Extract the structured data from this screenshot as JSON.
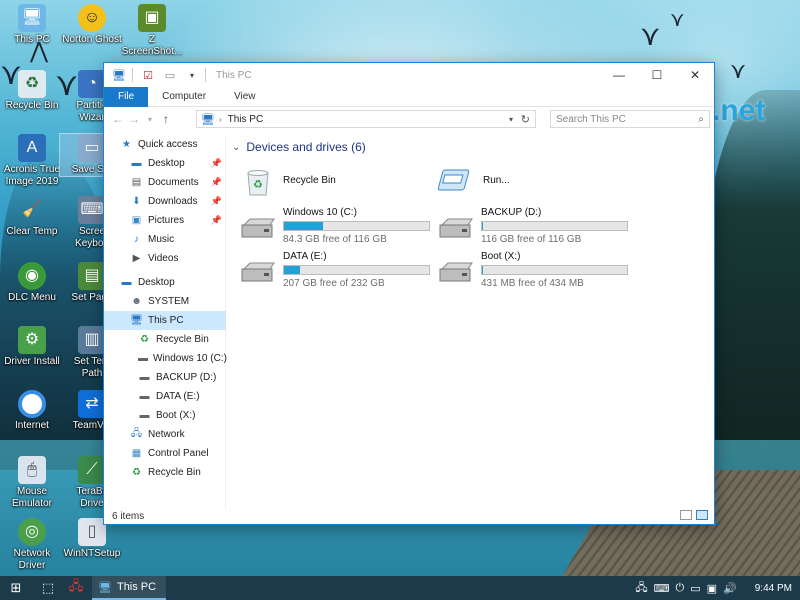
{
  "watermark": "freetuts.net",
  "desktop_icons": [
    {
      "label": "This PC",
      "icon": "computer-icon"
    },
    {
      "label": "Norton Ghost",
      "icon": "ghost-icon"
    },
    {
      "label": "Z",
      "label2": "ScreenShot...",
      "icon": "screenshot-icon"
    },
    {
      "label": "Recycle Bin",
      "icon": "recycle-bin-icon"
    },
    {
      "label": "Partitio",
      "label2": "Wizar",
      "icon": "partition-icon"
    },
    {
      "label": "Acronis True",
      "label2": "Image 2019",
      "icon": "acronis-icon"
    },
    {
      "label": "Save Scr",
      "icon": "save-screen-icon"
    },
    {
      "label": "Clear Temp",
      "icon": "broom-icon"
    },
    {
      "label": "Scree",
      "label2": "Keyboa",
      "icon": "keyboard-icon"
    },
    {
      "label": "DLC Menu",
      "icon": "dlc-menu-icon"
    },
    {
      "label": "Set Page",
      "icon": "page-file-icon"
    },
    {
      "label": "Driver Install",
      "icon": "driver-install-icon"
    },
    {
      "label": "Set Tem",
      "label2": "Path",
      "icon": "temp-path-icon"
    },
    {
      "label": "Internet",
      "icon": "chrome-icon"
    },
    {
      "label": "TeamVie",
      "icon": "teamviewer-icon"
    },
    {
      "label": "Mouse",
      "label2": "Emulator",
      "icon": "mouse-emulator-icon"
    },
    {
      "label": "TeraBy",
      "label2": "Drive",
      "icon": "terabyte-icon"
    },
    {
      "label": "Network",
      "label2": "Driver",
      "icon": "network-driver-icon"
    },
    {
      "label": "WinNTSetup",
      "icon": "winntsetup-icon"
    }
  ],
  "window": {
    "title": "This PC",
    "tabs": {
      "file": "File",
      "computer": "Computer",
      "view": "View"
    },
    "address": {
      "path": "This PC"
    },
    "search": {
      "placeholder": "Search This PC"
    },
    "controls": {
      "minimize": "—",
      "maximize": "☐",
      "close": "✕"
    }
  },
  "nav": {
    "items": [
      {
        "label": "Quick access",
        "icon": "star-icon",
        "pinned": false,
        "level": 0
      },
      {
        "label": "Desktop",
        "icon": "desktop-icon",
        "pinned": true,
        "level": 1
      },
      {
        "label": "Documents",
        "icon": "documents-icon",
        "pinned": true,
        "level": 1
      },
      {
        "label": "Downloads",
        "icon": "downloads-icon",
        "pinned": true,
        "level": 1
      },
      {
        "label": "Pictures",
        "icon": "pictures-icon",
        "pinned": true,
        "level": 1
      },
      {
        "label": "Music",
        "icon": "music-icon",
        "pinned": false,
        "level": 1
      },
      {
        "label": "Videos",
        "icon": "videos-icon",
        "pinned": false,
        "level": 1
      },
      {
        "label": "Desktop",
        "icon": "desktop-icon",
        "pinned": false,
        "level": 0
      },
      {
        "label": "SYSTEM",
        "icon": "user-icon",
        "pinned": false,
        "level": 1
      },
      {
        "label": "This PC",
        "icon": "computer-icon",
        "pinned": false,
        "level": 1,
        "selected": true
      },
      {
        "label": "Recycle Bin",
        "icon": "recycle-bin-icon",
        "pinned": false,
        "level": 2
      },
      {
        "label": "Windows 10 (C:)",
        "icon": "drive-icon",
        "pinned": false,
        "level": 2
      },
      {
        "label": "BACKUP (D:)",
        "icon": "drive-icon",
        "pinned": false,
        "level": 2
      },
      {
        "label": "DATA (E:)",
        "icon": "drive-icon",
        "pinned": false,
        "level": 2
      },
      {
        "label": "Boot (X:)",
        "icon": "drive-icon",
        "pinned": false,
        "level": 2
      },
      {
        "label": "Network",
        "icon": "network-icon",
        "pinned": false,
        "level": 1
      },
      {
        "label": "Control Panel",
        "icon": "control-panel-icon",
        "pinned": false,
        "level": 1
      },
      {
        "label": "Recycle Bin",
        "icon": "recycle-bin-icon",
        "pinned": false,
        "level": 1
      }
    ]
  },
  "content": {
    "group_title": "Devices and drives (6)",
    "shortcuts": [
      {
        "name": "Recycle Bin",
        "icon": "recycle-bin-icon"
      },
      {
        "name": "Run...",
        "icon": "run-icon"
      }
    ],
    "drives": [
      {
        "name": "Windows 10 (C:)",
        "free_text": "84.3 GB free of 116 GB",
        "used_fraction": 0.27
      },
      {
        "name": "BACKUP (D:)",
        "free_text": "116 GB free of 116 GB",
        "used_fraction": 0.005
      },
      {
        "name": "DATA (E:)",
        "free_text": "207 GB free of 232 GB",
        "used_fraction": 0.11
      },
      {
        "name": "Boot (X:)",
        "free_text": "431 MB free of 434 MB",
        "used_fraction": 0.01
      }
    ]
  },
  "status": {
    "items": "6 items"
  },
  "taskbar": {
    "active_app": "This PC",
    "time": "9:44 PM"
  },
  "colors": {
    "accent": "#1979ca",
    "drive_fill": "#26a0da",
    "watermark": "#27a6e0"
  }
}
